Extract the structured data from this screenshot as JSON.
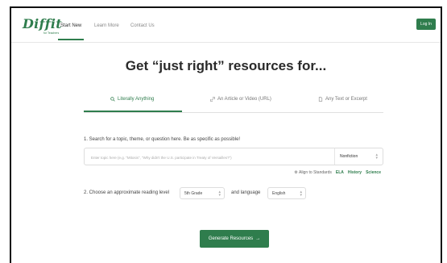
{
  "brand": {
    "logo": "Diffit",
    "logo_sub": "for Teachers"
  },
  "nav": {
    "links": [
      "Start New",
      "Learn More",
      "Contact Us"
    ],
    "login_label": "Log In"
  },
  "headline": "Get “just right” resources for...",
  "tabs": [
    {
      "icon": "search-icon",
      "label": "Literally Anything"
    },
    {
      "icon": "link-icon",
      "label": "An Article or Video (URL)"
    },
    {
      "icon": "document-icon",
      "label": "Any Text or Excerpt"
    }
  ],
  "step1": {
    "label": "1. Search for a topic, theme, or question here. Be as specific as possible!",
    "placeholder": "Enter topic here (e.g. \"Mitosis\", \"Why didn't the U.S. participate in Treaty of Versailles?\")",
    "type_value": "Nonfiction"
  },
  "align": {
    "label": "Align to Standards",
    "subjects": [
      "ELA",
      "History",
      "Science"
    ]
  },
  "step2": {
    "label": "2. Choose an approximate reading level",
    "grade_value": "5th Grade",
    "language_label": "and language",
    "language_value": "English"
  },
  "generate_label": "Generate Resources",
  "colors": {
    "accent": "#2f7d4d"
  }
}
